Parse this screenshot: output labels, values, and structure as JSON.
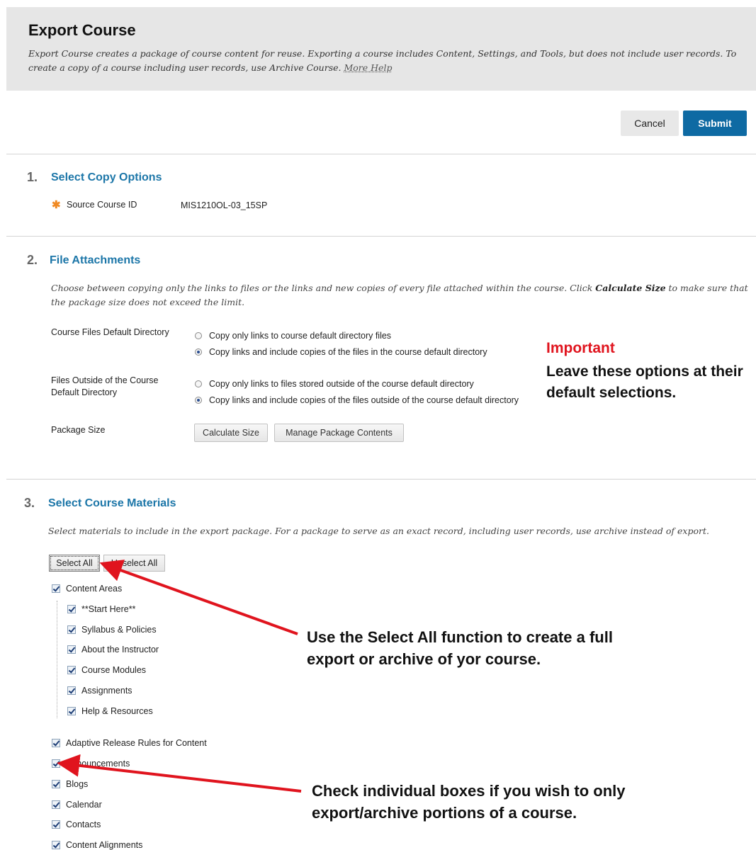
{
  "header": {
    "title": "Export Course",
    "description": "Export Course creates a package of course content for reuse. Exporting a course includes Content, Settings, and Tools, but does not include user records. To create a copy of a course including user records, use Archive Course.",
    "help_link": "More Help"
  },
  "actions": {
    "cancel": "Cancel",
    "submit": "Submit"
  },
  "section1": {
    "number": "1.",
    "title": "Select Copy Options",
    "source_label": "Source Course ID",
    "source_value": "MIS1210OL-03_15SP",
    "required_mark": "✱"
  },
  "section2": {
    "number": "2.",
    "title": "File Attachments",
    "instructions_pre": "Choose between copying only the links to files or the links and new copies of every file attached within the course. Click ",
    "instructions_bold": "Calculate Size",
    "instructions_post": " to make sure that the package size does not exceed the limit.",
    "course_files_label": "Course Files Default Directory",
    "course_files_options": [
      {
        "label": "Copy only links to course default directory files",
        "selected": false
      },
      {
        "label": "Copy links and include copies of the files in the course default directory",
        "selected": true
      }
    ],
    "outside_label": "Files Outside of the Course Default Directory",
    "outside_options": [
      {
        "label": "Copy only links to files stored outside of the course default directory",
        "selected": false
      },
      {
        "label": "Copy links and include copies of the files outside of the course default directory",
        "selected": true
      }
    ],
    "package_size_label": "Package Size",
    "calculate_size": "Calculate Size",
    "manage_contents": "Manage Package Contents"
  },
  "annotation_important": {
    "title": "Important",
    "text": "Leave these options at their default selections."
  },
  "section3": {
    "number": "3.",
    "title": "Select Course Materials",
    "instructions": "Select materials to include in the export package. For a package to serve as an exact record, including user records, use archive instead of export.",
    "select_all": "Select All",
    "unselect_all": "Unselect All",
    "content_areas": "Content Areas",
    "content_children": [
      "**Start Here**",
      "Syllabus & Policies",
      "About the Instructor",
      "Course Modules",
      "Assignments",
      "Help & Resources"
    ],
    "other_items": [
      "Adaptive Release Rules for Content",
      "Announcements",
      "Blogs",
      "Calendar",
      "Contacts",
      "Content Alignments"
    ]
  },
  "annotation_select_all": "Use the Select All function to create a full export or archive of yor course.",
  "annotation_individual": "Check individual boxes if you wish to only export/archive portions of a course.",
  "colors": {
    "accent_blue": "#1c76a8",
    "submit_blue": "#0e6aa3",
    "important_red": "#e0141e",
    "arrow_red": "#e0141e"
  }
}
